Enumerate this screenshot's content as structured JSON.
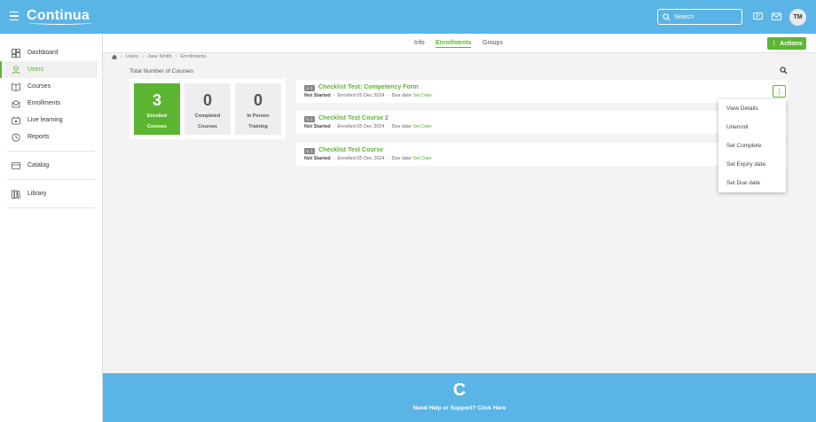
{
  "app": {
    "logo": "Continua",
    "avatar_initials": "TM"
  },
  "search": {
    "placeholder": "Search"
  },
  "sidebar": {
    "items": [
      {
        "label": "Dashboard",
        "icon": "dashboard-icon"
      },
      {
        "label": "Users",
        "icon": "user-icon",
        "active": true
      },
      {
        "label": "Courses",
        "icon": "book-icon"
      },
      {
        "label": "Enrollments",
        "icon": "enrollment-icon"
      },
      {
        "label": "Live learning",
        "icon": "live-learning-icon"
      },
      {
        "label": "Reports",
        "icon": "reports-icon"
      },
      {
        "label": "Catalog",
        "icon": "catalog-icon"
      },
      {
        "label": "Library",
        "icon": "library-icon"
      }
    ]
  },
  "tabs": [
    {
      "label": "Info"
    },
    {
      "label": "Enrollments",
      "active": true
    },
    {
      "label": "Groups"
    }
  ],
  "actions_label": "Actions",
  "breadcrumb": [
    "Users",
    "Jane Smith",
    "Enrollments"
  ],
  "total_label": "Total Number of Courses",
  "stats": [
    {
      "value": "3",
      "line1": "Enrolled",
      "line2": "Courses"
    },
    {
      "value": "0",
      "line1": "Completed",
      "line2": "Courses"
    },
    {
      "value": "0",
      "line1": "In Person",
      "line2": "Training"
    }
  ],
  "courses": [
    {
      "badge": "v. 1",
      "title": "Checklist Test: Competency Form",
      "status": "Not Started",
      "enrolled": "Enrolled 05 Dec 2024",
      "due_label": "Due date",
      "set_date": "Set Date"
    },
    {
      "badge": "v. 1",
      "title": "Checklist Test Course 2",
      "status": "Not Started",
      "enrolled": "Enrolled 05 Dec 2024",
      "due_label": "Due date",
      "set_date": "Set Date"
    },
    {
      "badge": "v. 1",
      "title": "Checklist Test Course",
      "status": "Not Started",
      "enrolled": "Enrolled 05 Dec 2024",
      "due_label": "Due date",
      "set_date": "Set Date"
    }
  ],
  "menu": [
    "View Details",
    "Unenroll",
    "Set Complete",
    "Set Expiry date",
    "Set Due date"
  ],
  "footer": {
    "logo_letter": "C",
    "help": "Need Help or Support? Click Here"
  },
  "colors": {
    "header": "#5ab4e5",
    "accent": "#5bb531"
  }
}
